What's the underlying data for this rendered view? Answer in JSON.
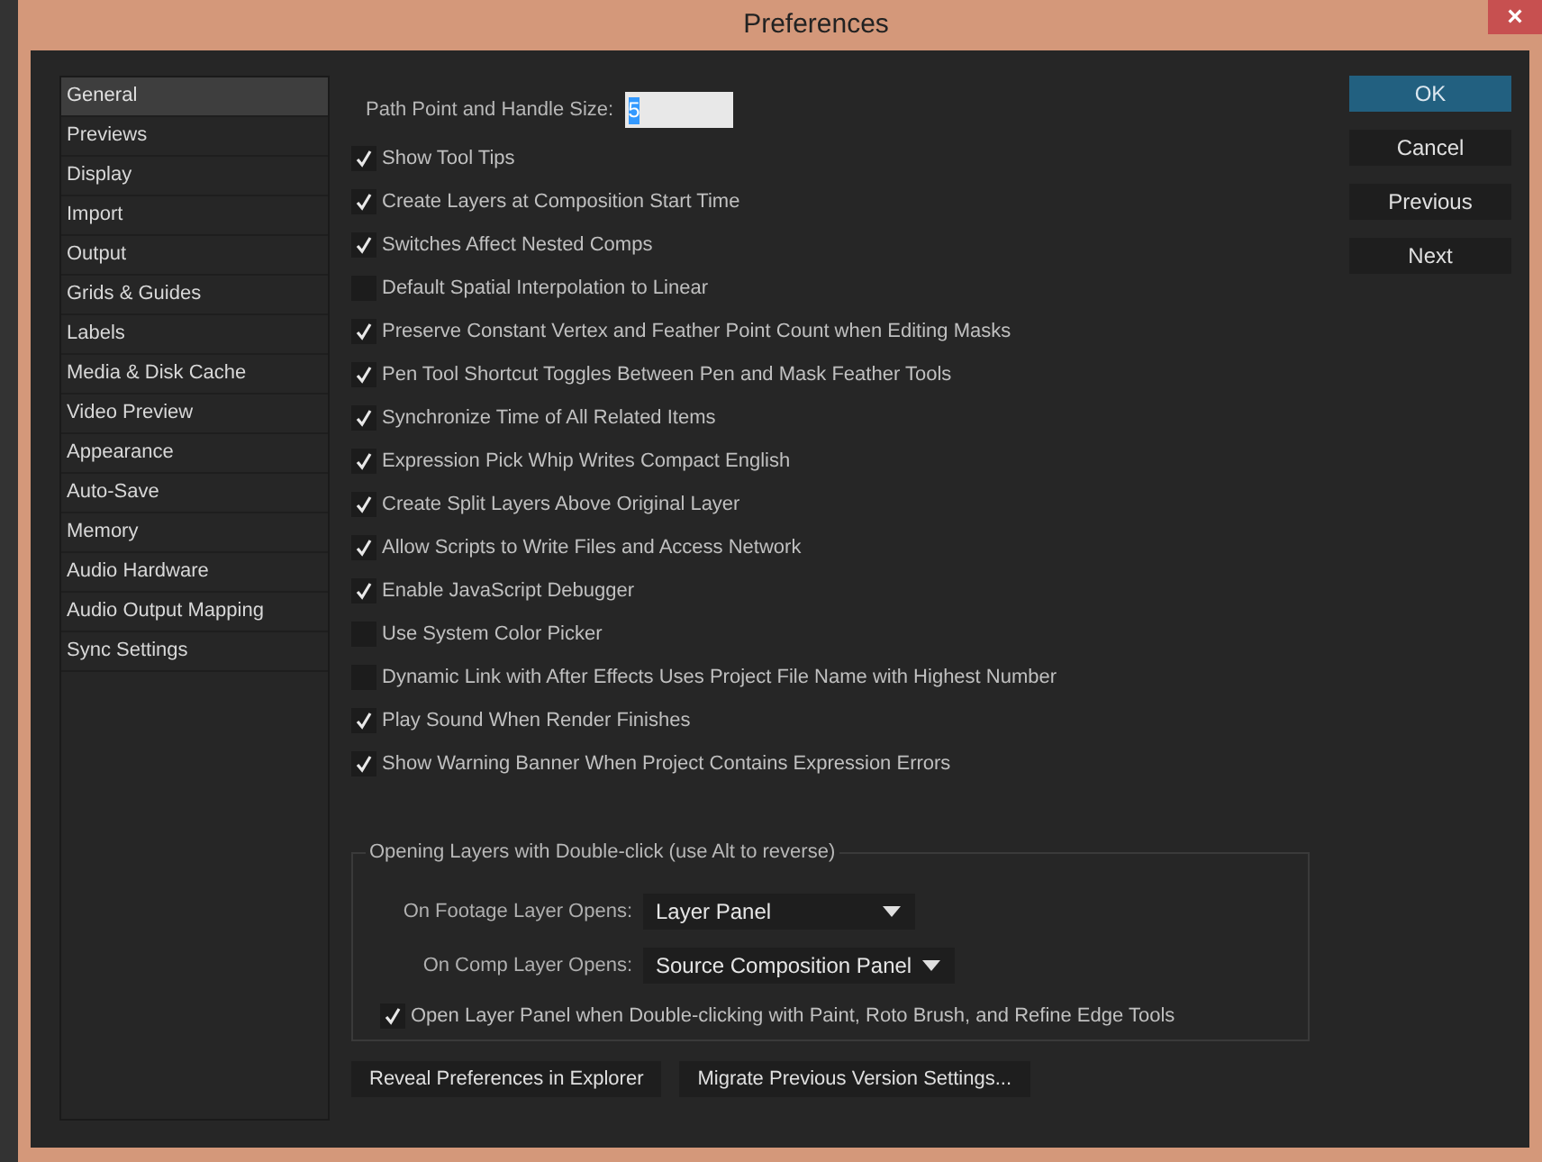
{
  "window": {
    "title": "Preferences",
    "close": "×"
  },
  "sidebar": {
    "items": [
      {
        "label": "General",
        "selected": true
      },
      {
        "label": "Previews",
        "selected": false
      },
      {
        "label": "Display",
        "selected": false
      },
      {
        "label": "Import",
        "selected": false
      },
      {
        "label": "Output",
        "selected": false
      },
      {
        "label": "Grids & Guides",
        "selected": false
      },
      {
        "label": "Labels",
        "selected": false
      },
      {
        "label": "Media & Disk Cache",
        "selected": false
      },
      {
        "label": "Video Preview",
        "selected": false
      },
      {
        "label": "Appearance",
        "selected": false
      },
      {
        "label": "Auto-Save",
        "selected": false
      },
      {
        "label": "Memory",
        "selected": false
      },
      {
        "label": "Audio Hardware",
        "selected": false
      },
      {
        "label": "Audio Output Mapping",
        "selected": false
      },
      {
        "label": "Sync Settings",
        "selected": false
      }
    ]
  },
  "path_point_size": {
    "label": "Path Point and Handle Size:",
    "value": "5"
  },
  "options": [
    {
      "label": "Show Tool Tips",
      "checked": true
    },
    {
      "label": "Create Layers at Composition Start Time",
      "checked": true
    },
    {
      "label": "Switches Affect Nested Comps",
      "checked": true
    },
    {
      "label": "Default Spatial Interpolation to Linear",
      "checked": false
    },
    {
      "label": "Preserve Constant Vertex and Feather Point Count when Editing Masks",
      "checked": true
    },
    {
      "label": "Pen Tool Shortcut Toggles Between Pen and Mask Feather Tools",
      "checked": true
    },
    {
      "label": "Synchronize Time of All Related Items",
      "checked": true
    },
    {
      "label": "Expression Pick Whip Writes Compact English",
      "checked": true
    },
    {
      "label": "Create Split Layers Above Original Layer",
      "checked": true
    },
    {
      "label": "Allow Scripts to Write Files and Access Network",
      "checked": true
    },
    {
      "label": "Enable JavaScript Debugger",
      "checked": true
    },
    {
      "label": "Use System Color Picker",
      "checked": false
    },
    {
      "label": "Dynamic Link with After Effects Uses Project File Name with Highest Number",
      "checked": false
    },
    {
      "label": "Play Sound When Render Finishes",
      "checked": true
    },
    {
      "label": "Show Warning Banner When Project Contains Expression Errors",
      "checked": true
    }
  ],
  "double_click_group": {
    "title": "Opening Layers with Double-click (use Alt to reverse)",
    "dropdowns": [
      {
        "label": "On Footage Layer Opens:",
        "value": "Layer Panel"
      },
      {
        "label": "On Comp Layer Opens:",
        "value": "Source Composition Panel"
      }
    ],
    "option": {
      "label": "Open Layer Panel when Double-clicking with Paint, Roto Brush, and Refine Edge Tools",
      "checked": true
    }
  },
  "bottom_buttons": [
    "Reveal Preferences in Explorer",
    "Migrate Previous Version Settings..."
  ],
  "side_buttons": [
    {
      "label": "OK",
      "primary": true
    },
    {
      "label": "Cancel",
      "primary": false
    },
    {
      "label": "Previous",
      "primary": false
    },
    {
      "label": "Next",
      "primary": false
    }
  ]
}
